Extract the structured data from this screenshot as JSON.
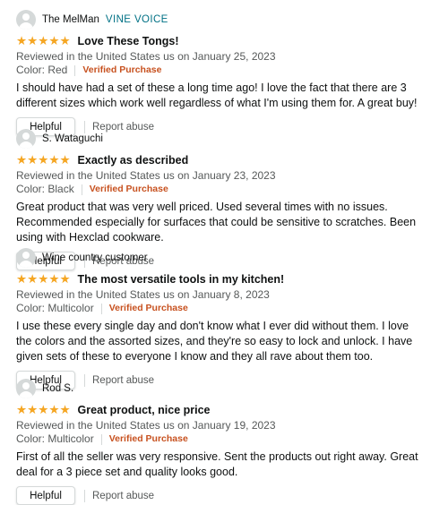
{
  "reviews": [
    {
      "reviewer": "The MelMan",
      "badge": "VINE VOICE",
      "rating_stars": 5,
      "title": "Love These Tongs!",
      "meta": "Reviewed in the United States us on January 25, 2023",
      "variant": "Color: Red",
      "verified": "Verified Purchase",
      "body": "I should have had a set of these a long time ago! I love the fact that there are 3 different sizes which work well regardless of what I'm using them for. A great buy!",
      "helpful_label": "Helpful",
      "report_label": "Report abuse"
    },
    {
      "reviewer": "S. Wataguchi",
      "badge": "",
      "rating_stars": 5,
      "title": "Exactly as described",
      "meta": "Reviewed in the United States us on January 23, 2023",
      "variant": "Color: Black",
      "verified": "Verified Purchase",
      "body": "Great product that was very well priced. Used several times with no issues. Recommended especially for surfaces that could be sensitive to scratches. Been using with Hexclad cookware.",
      "helpful_label": "Helpful",
      "report_label": "Report abuse"
    },
    {
      "reviewer": "Wine country customer",
      "badge": "",
      "rating_stars": 5,
      "title": "The most versatile tools in my kitchen!",
      "meta": "Reviewed in the United States us on January 8, 2023",
      "variant": "Color: Multicolor",
      "verified": "Verified Purchase",
      "body": "I use these every single day and don't know what I ever did without them. I love the colors and the assorted sizes, and they're so easy to lock and unlock. I have given sets of these to everyone I know and they all rave about them too.",
      "helpful_label": "Helpful",
      "report_label": "Report abuse"
    },
    {
      "reviewer": "Rod S.",
      "badge": "",
      "rating_stars": 5,
      "title": "Great product, nice price",
      "meta": "Reviewed in the United States us on January 19, 2023",
      "variant": "Color: Multicolor",
      "verified": "Verified Purchase",
      "body": "First of all the seller was very responsive. Sent the products out right away. Great deal for a 3 piece set and quality looks good.",
      "helpful_label": "Helpful",
      "report_label": "Report abuse"
    }
  ],
  "colors": {
    "star": "#F5A623",
    "verified": "#C7511F",
    "vine": "#007185",
    "meta": "#565959"
  },
  "icons": {
    "avatar": "default-user-avatar-icon",
    "star": "star-icon"
  }
}
